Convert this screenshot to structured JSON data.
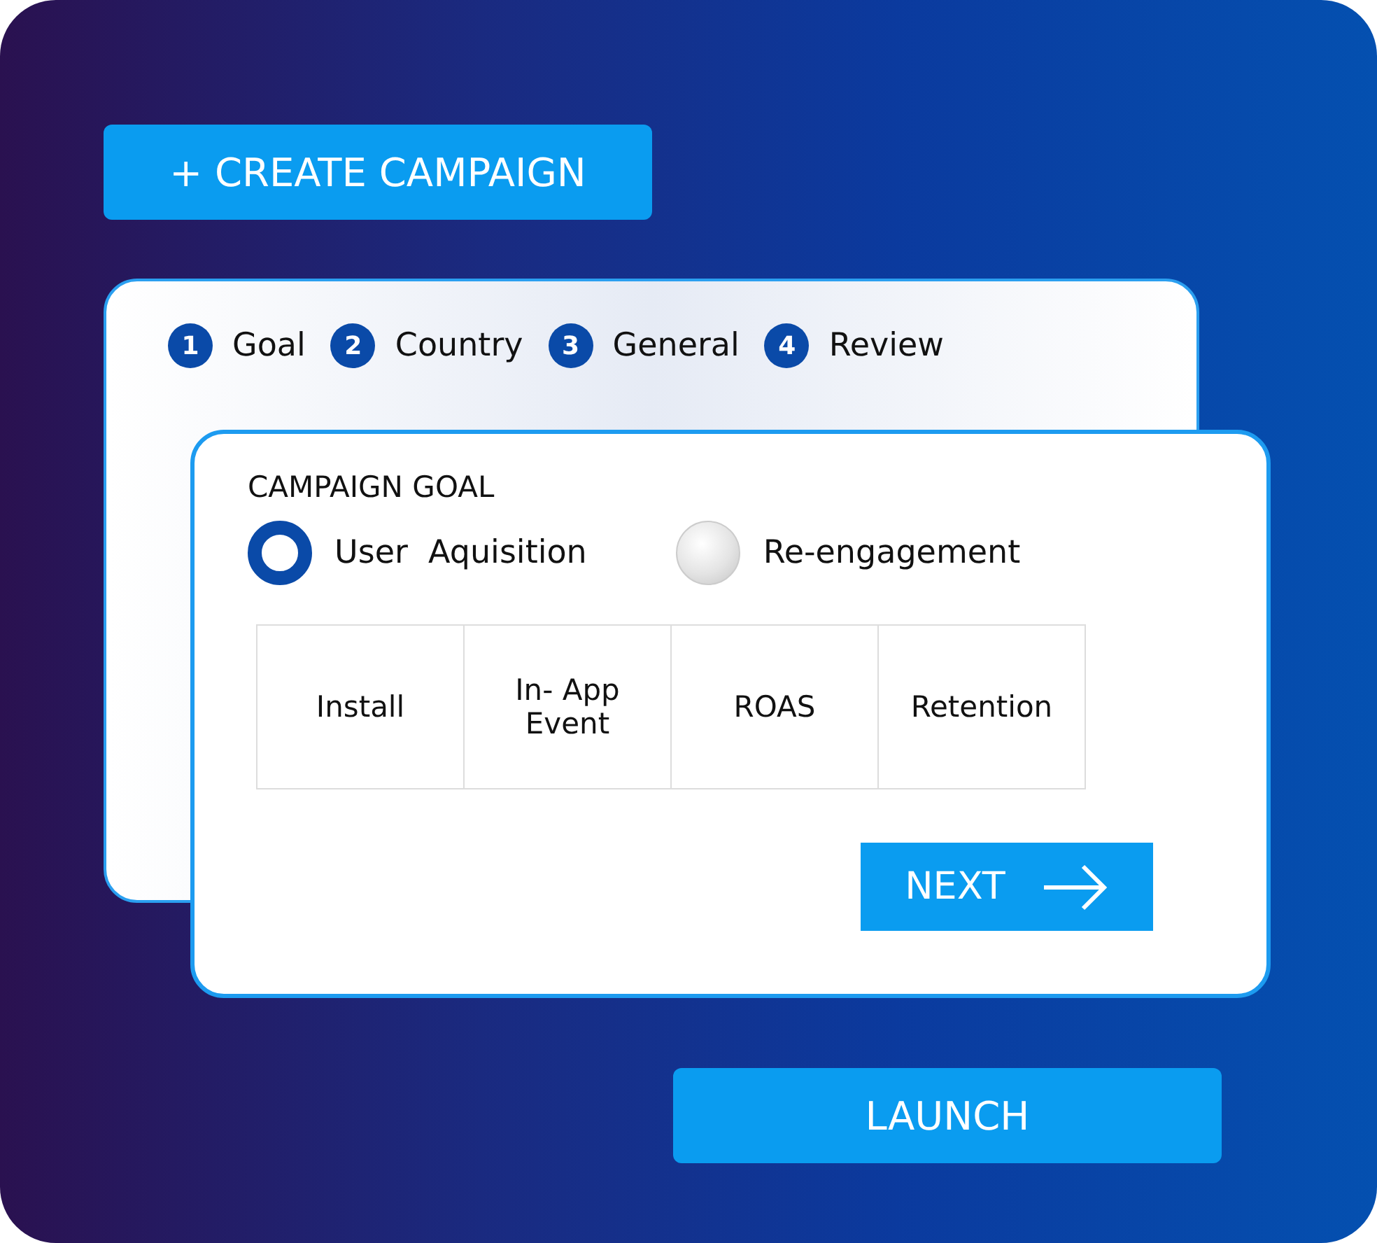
{
  "create_button": {
    "label": "+ CREATE CAMPAIGN"
  },
  "steps": [
    {
      "number": "1",
      "label": "Goal"
    },
    {
      "number": "2",
      "label": "Country"
    },
    {
      "number": "3",
      "label": "General"
    },
    {
      "number": "4",
      "label": "Review"
    }
  ],
  "goal_card": {
    "title": "CAMPAIGN GOAL",
    "options": [
      {
        "label": "User  Aquisition",
        "selected": true
      },
      {
        "label": "Re-engagement",
        "selected": false
      }
    ],
    "goals": [
      "Install",
      "In- App Event",
      "ROAS",
      "Retention"
    ],
    "next_button": {
      "label": "NEXT"
    }
  },
  "launch_button": {
    "label": "LAUNCH"
  }
}
